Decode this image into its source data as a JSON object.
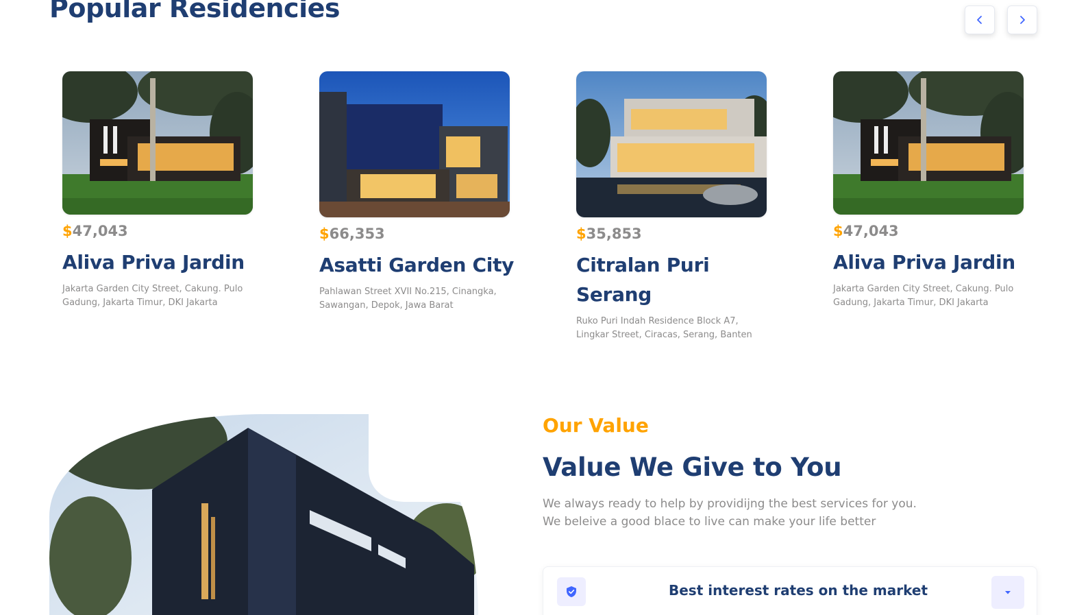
{
  "residencies": {
    "title": "Popular Residencies",
    "cards": [
      {
        "currency": "$",
        "price": "47,043",
        "name": "Aliva Priva Jardin",
        "detail": "Jakarta Garden City Street, Cakung. Pulo Gadung, Jakarta Timur, DKI Jakarta"
      },
      {
        "currency": "$",
        "price": "66,353",
        "name": "Asatti Garden City",
        "detail": "Pahlawan Street XVII No.215, Cinangka, Sawangan, Depok, Jawa Barat"
      },
      {
        "currency": "$",
        "price": "35,853",
        "name": "Citralan Puri Serang",
        "detail": "Ruko Puri Indah Residence Block A7, Lingkar Street, Ciracas, Serang, Banten"
      },
      {
        "currency": "$",
        "price": "47,043",
        "name": "Aliva Priva Jardin",
        "detail": "Jakarta Garden City Street, Cakung. Pulo Gadung, Jakarta Timur, DKI Jakarta"
      }
    ]
  },
  "value": {
    "label": "Our Value",
    "heading": "Value We Give to You",
    "desc_line1": "We always ready to help by providijng the best services for you.",
    "desc_line2": "We beleive a good blace to live can make your life better",
    "accordion": {
      "title": "Best interest rates on the market"
    }
  },
  "colors": {
    "primary": "#1f3e72",
    "accent": "#ffa300",
    "secondary_text": "#8c8b8b",
    "nav_arrow": "#4066ff"
  },
  "icons": {
    "prev": "chevron-left-icon",
    "next": "chevron-right-icon",
    "accordion": "shield-check-icon",
    "toggle": "caret-down-icon"
  }
}
